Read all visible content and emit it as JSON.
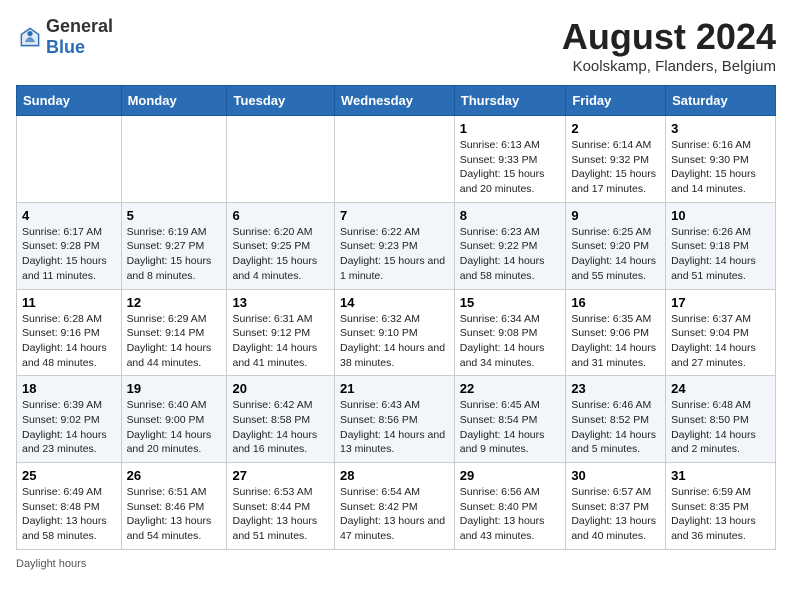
{
  "header": {
    "logo_general": "General",
    "logo_blue": "Blue",
    "month_year": "August 2024",
    "location": "Koolskamp, Flanders, Belgium"
  },
  "days_of_week": [
    "Sunday",
    "Monday",
    "Tuesday",
    "Wednesday",
    "Thursday",
    "Friday",
    "Saturday"
  ],
  "weeks": [
    [
      {
        "day": "",
        "sunrise": "",
        "sunset": "",
        "daylight": ""
      },
      {
        "day": "",
        "sunrise": "",
        "sunset": "",
        "daylight": ""
      },
      {
        "day": "",
        "sunrise": "",
        "sunset": "",
        "daylight": ""
      },
      {
        "day": "",
        "sunrise": "",
        "sunset": "",
        "daylight": ""
      },
      {
        "day": "1",
        "sunrise": "Sunrise: 6:13 AM",
        "sunset": "Sunset: 9:33 PM",
        "daylight": "Daylight: 15 hours and 20 minutes."
      },
      {
        "day": "2",
        "sunrise": "Sunrise: 6:14 AM",
        "sunset": "Sunset: 9:32 PM",
        "daylight": "Daylight: 15 hours and 17 minutes."
      },
      {
        "day": "3",
        "sunrise": "Sunrise: 6:16 AM",
        "sunset": "Sunset: 9:30 PM",
        "daylight": "Daylight: 15 hours and 14 minutes."
      }
    ],
    [
      {
        "day": "4",
        "sunrise": "Sunrise: 6:17 AM",
        "sunset": "Sunset: 9:28 PM",
        "daylight": "Daylight: 15 hours and 11 minutes."
      },
      {
        "day": "5",
        "sunrise": "Sunrise: 6:19 AM",
        "sunset": "Sunset: 9:27 PM",
        "daylight": "Daylight: 15 hours and 8 minutes."
      },
      {
        "day": "6",
        "sunrise": "Sunrise: 6:20 AM",
        "sunset": "Sunset: 9:25 PM",
        "daylight": "Daylight: 15 hours and 4 minutes."
      },
      {
        "day": "7",
        "sunrise": "Sunrise: 6:22 AM",
        "sunset": "Sunset: 9:23 PM",
        "daylight": "Daylight: 15 hours and 1 minute."
      },
      {
        "day": "8",
        "sunrise": "Sunrise: 6:23 AM",
        "sunset": "Sunset: 9:22 PM",
        "daylight": "Daylight: 14 hours and 58 minutes."
      },
      {
        "day": "9",
        "sunrise": "Sunrise: 6:25 AM",
        "sunset": "Sunset: 9:20 PM",
        "daylight": "Daylight: 14 hours and 55 minutes."
      },
      {
        "day": "10",
        "sunrise": "Sunrise: 6:26 AM",
        "sunset": "Sunset: 9:18 PM",
        "daylight": "Daylight: 14 hours and 51 minutes."
      }
    ],
    [
      {
        "day": "11",
        "sunrise": "Sunrise: 6:28 AM",
        "sunset": "Sunset: 9:16 PM",
        "daylight": "Daylight: 14 hours and 48 minutes."
      },
      {
        "day": "12",
        "sunrise": "Sunrise: 6:29 AM",
        "sunset": "Sunset: 9:14 PM",
        "daylight": "Daylight: 14 hours and 44 minutes."
      },
      {
        "day": "13",
        "sunrise": "Sunrise: 6:31 AM",
        "sunset": "Sunset: 9:12 PM",
        "daylight": "Daylight: 14 hours and 41 minutes."
      },
      {
        "day": "14",
        "sunrise": "Sunrise: 6:32 AM",
        "sunset": "Sunset: 9:10 PM",
        "daylight": "Daylight: 14 hours and 38 minutes."
      },
      {
        "day": "15",
        "sunrise": "Sunrise: 6:34 AM",
        "sunset": "Sunset: 9:08 PM",
        "daylight": "Daylight: 14 hours and 34 minutes."
      },
      {
        "day": "16",
        "sunrise": "Sunrise: 6:35 AM",
        "sunset": "Sunset: 9:06 PM",
        "daylight": "Daylight: 14 hours and 31 minutes."
      },
      {
        "day": "17",
        "sunrise": "Sunrise: 6:37 AM",
        "sunset": "Sunset: 9:04 PM",
        "daylight": "Daylight: 14 hours and 27 minutes."
      }
    ],
    [
      {
        "day": "18",
        "sunrise": "Sunrise: 6:39 AM",
        "sunset": "Sunset: 9:02 PM",
        "daylight": "Daylight: 14 hours and 23 minutes."
      },
      {
        "day": "19",
        "sunrise": "Sunrise: 6:40 AM",
        "sunset": "Sunset: 9:00 PM",
        "daylight": "Daylight: 14 hours and 20 minutes."
      },
      {
        "day": "20",
        "sunrise": "Sunrise: 6:42 AM",
        "sunset": "Sunset: 8:58 PM",
        "daylight": "Daylight: 14 hours and 16 minutes."
      },
      {
        "day": "21",
        "sunrise": "Sunrise: 6:43 AM",
        "sunset": "Sunset: 8:56 PM",
        "daylight": "Daylight: 14 hours and 13 minutes."
      },
      {
        "day": "22",
        "sunrise": "Sunrise: 6:45 AM",
        "sunset": "Sunset: 8:54 PM",
        "daylight": "Daylight: 14 hours and 9 minutes."
      },
      {
        "day": "23",
        "sunrise": "Sunrise: 6:46 AM",
        "sunset": "Sunset: 8:52 PM",
        "daylight": "Daylight: 14 hours and 5 minutes."
      },
      {
        "day": "24",
        "sunrise": "Sunrise: 6:48 AM",
        "sunset": "Sunset: 8:50 PM",
        "daylight": "Daylight: 14 hours and 2 minutes."
      }
    ],
    [
      {
        "day": "25",
        "sunrise": "Sunrise: 6:49 AM",
        "sunset": "Sunset: 8:48 PM",
        "daylight": "Daylight: 13 hours and 58 minutes."
      },
      {
        "day": "26",
        "sunrise": "Sunrise: 6:51 AM",
        "sunset": "Sunset: 8:46 PM",
        "daylight": "Daylight: 13 hours and 54 minutes."
      },
      {
        "day": "27",
        "sunrise": "Sunrise: 6:53 AM",
        "sunset": "Sunset: 8:44 PM",
        "daylight": "Daylight: 13 hours and 51 minutes."
      },
      {
        "day": "28",
        "sunrise": "Sunrise: 6:54 AM",
        "sunset": "Sunset: 8:42 PM",
        "daylight": "Daylight: 13 hours and 47 minutes."
      },
      {
        "day": "29",
        "sunrise": "Sunrise: 6:56 AM",
        "sunset": "Sunset: 8:40 PM",
        "daylight": "Daylight: 13 hours and 43 minutes."
      },
      {
        "day": "30",
        "sunrise": "Sunrise: 6:57 AM",
        "sunset": "Sunset: 8:37 PM",
        "daylight": "Daylight: 13 hours and 40 minutes."
      },
      {
        "day": "31",
        "sunrise": "Sunrise: 6:59 AM",
        "sunset": "Sunset: 8:35 PM",
        "daylight": "Daylight: 13 hours and 36 minutes."
      }
    ]
  ],
  "footer": {
    "daylight_label": "Daylight hours"
  },
  "colors": {
    "header_bg": "#2a6db5",
    "accent": "#1a6bb5"
  }
}
